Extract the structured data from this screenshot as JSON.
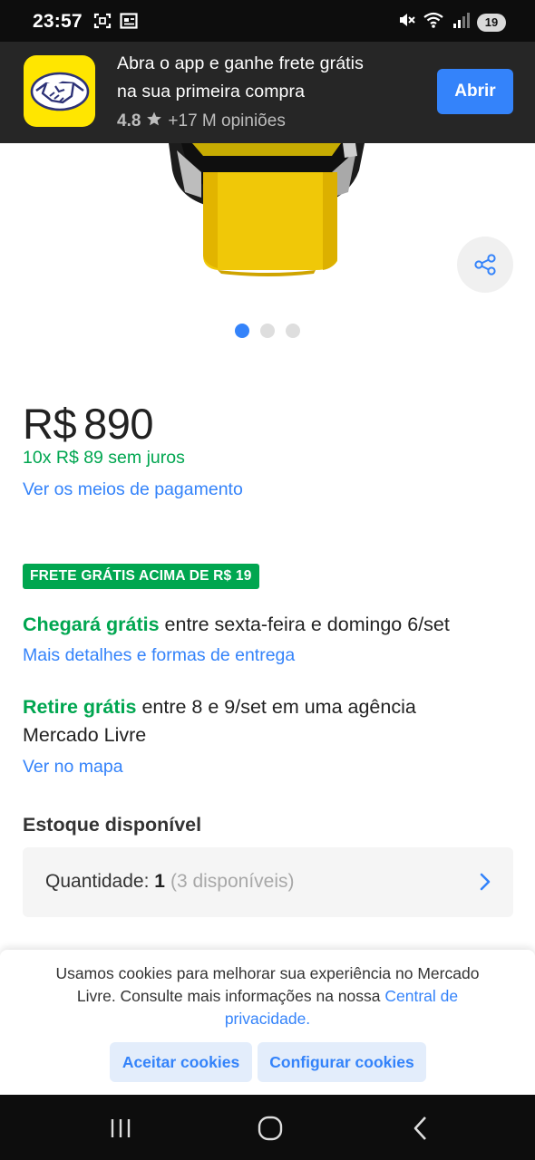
{
  "status_bar": {
    "time": "23:57",
    "battery": "19",
    "icons": [
      "screenshot-icon",
      "gallery-icon",
      "mute-icon",
      "wifi-icon",
      "signal-icon",
      "battery-icon"
    ]
  },
  "app_banner": {
    "line1": "Abra o app e ganhe frete grátis",
    "line2": "na sua primeira compra",
    "rating": "4.8",
    "reviews": "+17 M opiniões",
    "open_label": "Abrir",
    "logo_color": "#ffe600"
  },
  "product": {
    "carousel": {
      "total": 3,
      "active": 1
    },
    "price_symbol": "R$",
    "price_value": "890",
    "installments": "10x R$ 89 sem juros",
    "payment_link": "Ver os meios de pagamento"
  },
  "shipping": {
    "badge": "FRETE GRÁTIS ACIMA DE R$ 19",
    "arrival_strong": "Chegará grátis",
    "arrival_rest": " entre sexta-feira e domingo 6/set",
    "delivery_link": "Mais detalhes e formas de entrega",
    "pickup_strong": "Retire grátis",
    "pickup_rest": " entre 8 e 9/set em uma agência",
    "pickup_line2": "Mercado Livre",
    "map_link": "Ver no mapa"
  },
  "stock": {
    "title": "Estoque disponível",
    "quantity_label": "Quantidade: ",
    "quantity_value": "1",
    "available": "(3 disponíveis)"
  },
  "cookies": {
    "text": "Usamos cookies para melhorar sua experiência no Mercado Livre. Consulte mais informações na nossa ",
    "link": "Central de privacidade.",
    "accept_label": "Aceitar cookies",
    "config_label": "Configurar cookies"
  },
  "colors": {
    "accent": "#3483fa",
    "green": "#00a650",
    "brand_yellow": "#ffe600"
  }
}
